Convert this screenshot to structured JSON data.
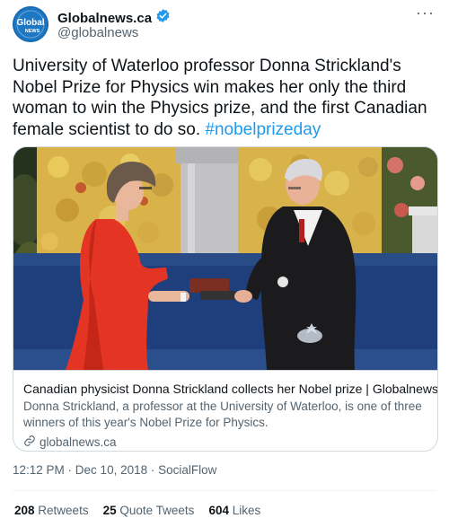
{
  "header": {
    "display_name": "Globalnews.ca",
    "handle": "@globalnews",
    "avatar_line1": "Global",
    "avatar_line2": "NEWS",
    "more_label": "···"
  },
  "tweet": {
    "text": "University of Waterloo professor Donna Strickland's Nobel Prize for Physics win makes her only the third woman to win the Physics prize, and the first Canadian female scientist to do so. ",
    "hashtag": "#nobelprizeday"
  },
  "card": {
    "title": "Canadian physicist Donna Strickland collects her Nobel prize | Globalnews.ca",
    "description": "Donna Strickland, a professor at the University of Waterloo, is one of three winners of this year's Nobel Prize for Physics.",
    "domain": "globalnews.ca"
  },
  "meta": {
    "time": "12:12 PM",
    "date": "Dec 10, 2018",
    "source": "SocialFlow",
    "separator": " · "
  },
  "stats": {
    "retweets_count": "208",
    "retweets_label": "Retweets",
    "quotes_count": "25",
    "quotes_label": "Quote Tweets",
    "likes_count": "604",
    "likes_label": "Likes"
  },
  "colors": {
    "accent": "#1d9bf0",
    "avatar_bg": "#1d77c2",
    "text_primary": "#0f1419",
    "text_secondary": "#536471",
    "border": "#cfd9de"
  },
  "icons": {
    "verified": "verified-badge-icon",
    "link": "link-icon",
    "more": "more-options-icon"
  }
}
